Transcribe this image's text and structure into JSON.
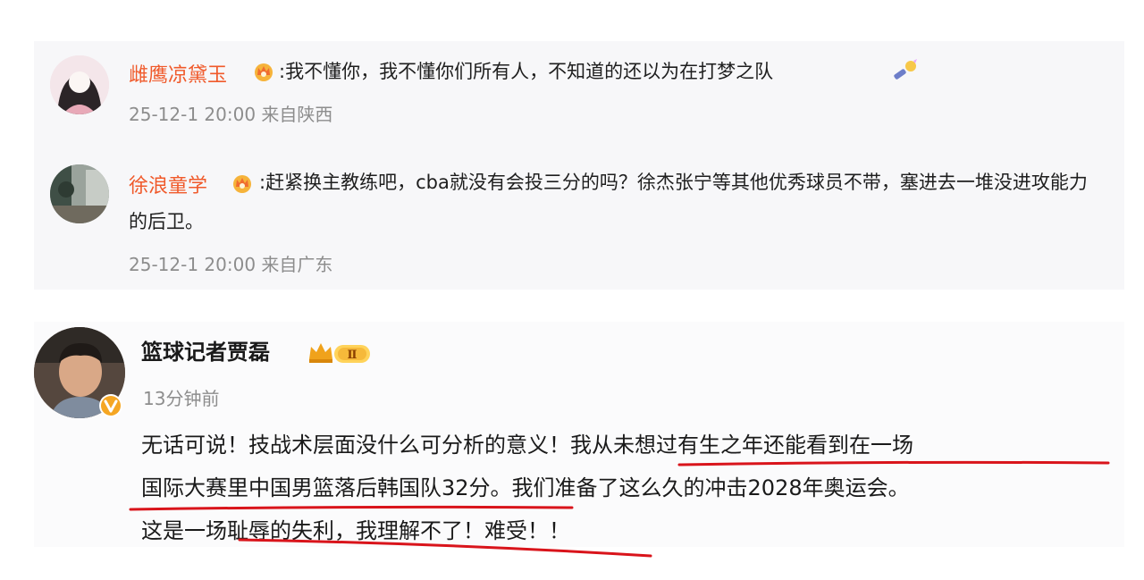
{
  "comments": [
    {
      "username": "雌鹰凉黛玉",
      "badge_icon": "crown-badge-icon",
      "text": ":我不懂你，我不懂你们所有人，不知道的还以为在打梦之队",
      "trailing_icon": "microphone-emoji-icon",
      "time": "25-12-1 20:00",
      "location": "来自陕西"
    },
    {
      "username": "徐浪童学",
      "badge_icon": "crown-badge-icon",
      "text": ":赶紧换主教练吧，cba就没有会投三分的吗？徐杰张宁等其他优秀球员不带，塞进去一堆没进攻能力的后卫。",
      "time": "25-12-1 20:00",
      "location": "来自广东"
    }
  ],
  "post": {
    "author": "篮球记者贾磊",
    "level_badge": "Ⅱ",
    "verified_icon": "verified-badge-icon",
    "time": "13分钟前",
    "lines": [
      "无话可说！技战术层面没什么可分析的意义！我从未想过有生之年还能看到在一场",
      "国际大赛里中国男篮落后韩国队32分。我们准备了这么久的冲击2028年奥运会。",
      "这是一场耻辱的失利，我理解不了！难受！！"
    ]
  },
  "colors": {
    "username": "#f05a2b",
    "meta": "#8d8d8d",
    "underline": "#d9141b",
    "verified": "#f5a623"
  }
}
